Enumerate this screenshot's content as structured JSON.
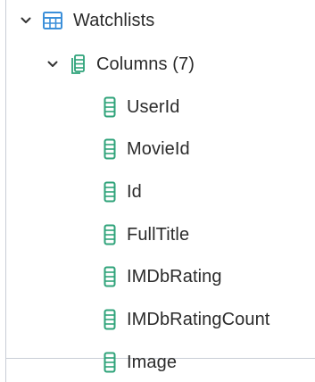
{
  "tree": {
    "table": {
      "label": "Watchlists",
      "icon": "table-icon",
      "expanded": true
    },
    "columns_group": {
      "label": "Columns (7)",
      "icon": "columns-icon",
      "expanded": true
    },
    "columns": [
      {
        "label": "UserId",
        "icon": "column-icon"
      },
      {
        "label": "MovieId",
        "icon": "column-icon"
      },
      {
        "label": "Id",
        "icon": "column-icon"
      },
      {
        "label": "FullTitle",
        "icon": "column-icon"
      },
      {
        "label": "IMDbRating",
        "icon": "column-icon"
      },
      {
        "label": "IMDbRatingCount",
        "icon": "column-icon"
      },
      {
        "label": "Image",
        "icon": "column-icon"
      }
    ]
  },
  "colors": {
    "table_icon": "#3b8fd9",
    "column_icon": "#2fa37a",
    "border": "#c9ced6"
  }
}
